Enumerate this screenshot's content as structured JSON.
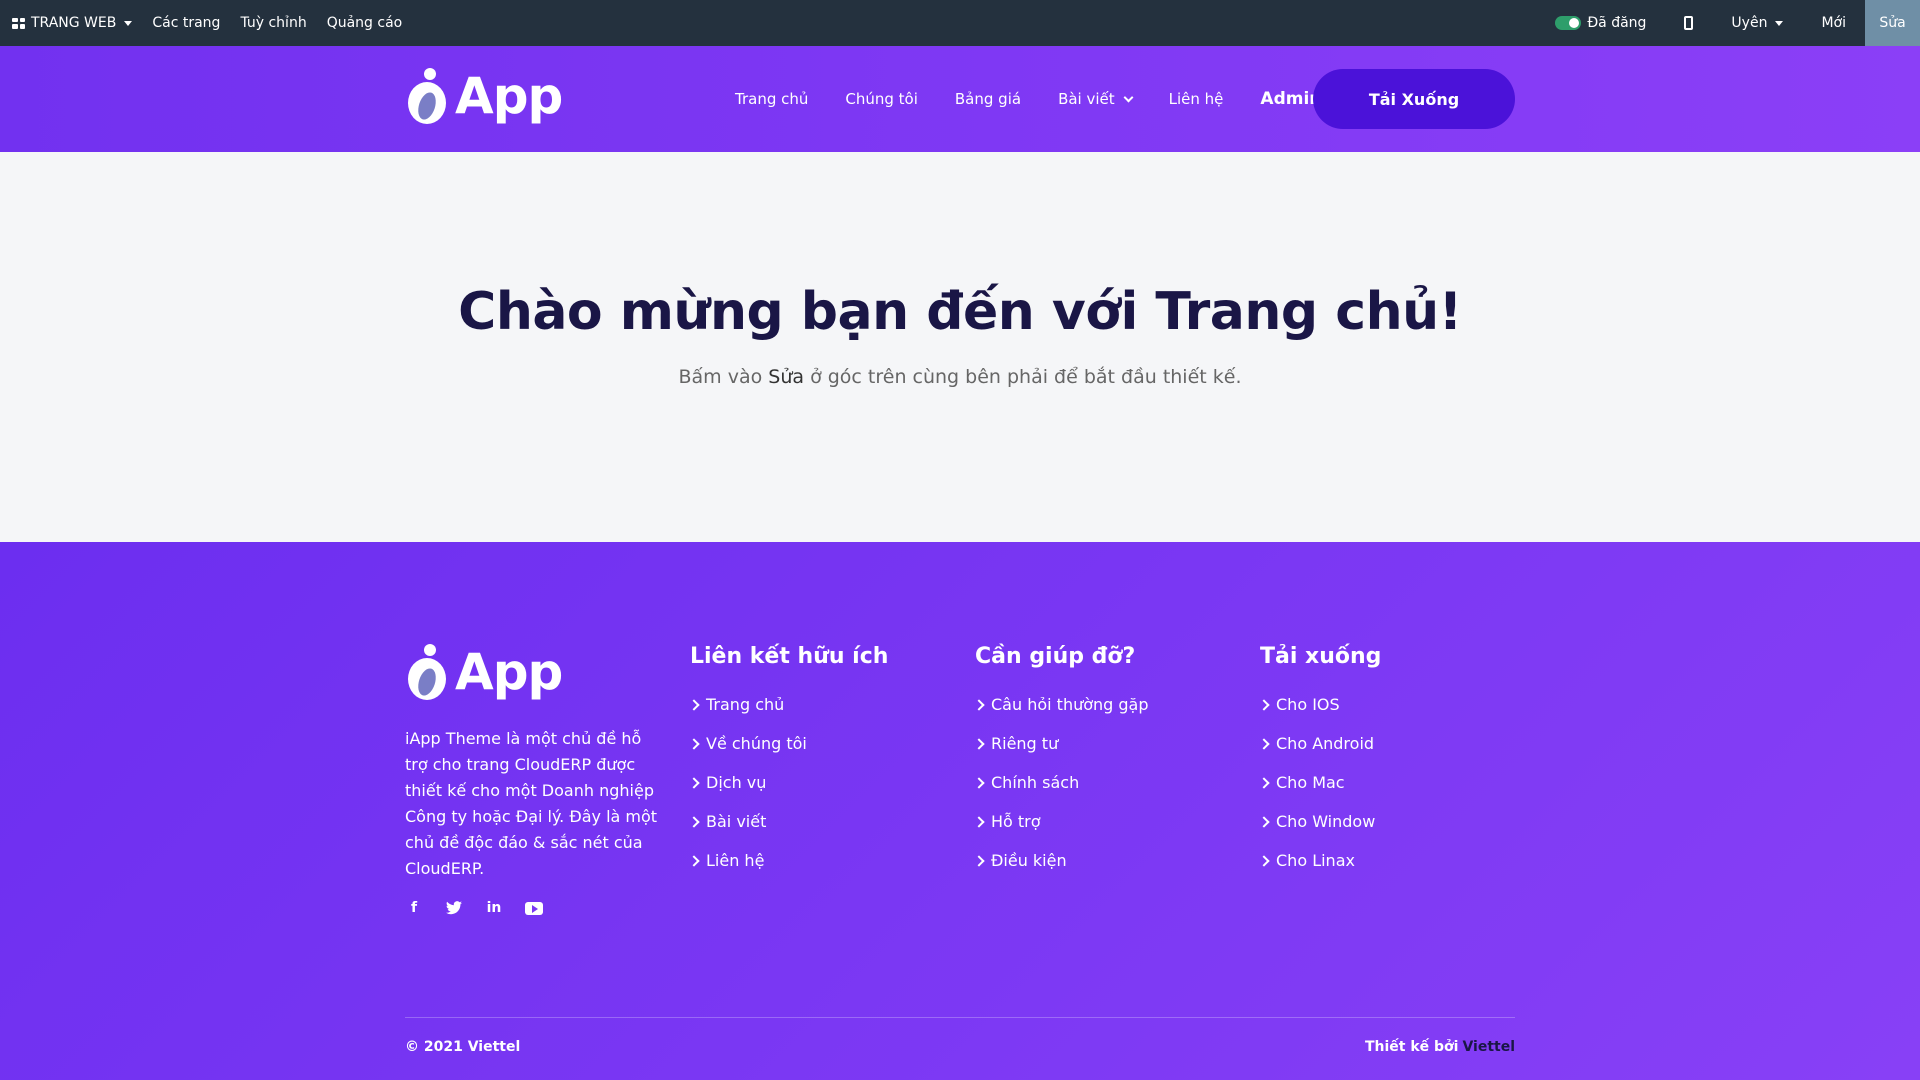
{
  "adminbar": {
    "site_label": "TRANG WEB",
    "pages": "Các trang",
    "customize": "Tuỳ chỉnh",
    "ads": "Quảng cáo",
    "published": "Đã đăng",
    "user": "Uyên",
    "new": "Mới",
    "edit": "Sửa"
  },
  "header": {
    "logo_text": "App",
    "nav": [
      "Trang chủ",
      "Chúng tôi",
      "Bảng giá",
      "Bài viết",
      "Liên hệ",
      "Admin"
    ],
    "download": "Tải Xuống"
  },
  "hero": {
    "title": "Chào mừng bạn đến với Trang chủ!",
    "subtitle_before": "Bấm vào ",
    "subtitle_bold": "Sửa",
    "subtitle_after": " ở góc trên cùng bên phải để bắt đầu thiết kế."
  },
  "footer": {
    "logo_text": "App",
    "about": "iApp Theme là một chủ đề hỗ trợ cho trang CloudERP được thiết kế cho một Doanh nghiệp Công ty hoặc Đại lý. Đây là một chủ đề độc đáo & sắc nét của CloudERP.",
    "columns": [
      {
        "title": "Liên kết hữu ích",
        "links": [
          "Trang chủ",
          "Về chúng tôi",
          "Dịch vụ",
          "Bài viết",
          "Liên hệ"
        ]
      },
      {
        "title": "Cần giúp đỡ?",
        "links": [
          "Câu hỏi thường gặp",
          "Riêng tư",
          "Chính sách",
          "Hỗ trợ",
          "Điều kiện"
        ]
      },
      {
        "title": "Tải xuống",
        "links": [
          "Cho IOS",
          "Cho Android",
          "Cho Mac",
          "Cho Window",
          "Cho Linax"
        ]
      }
    ],
    "socials": [
      "facebook-icon",
      "twitter-icon",
      "linkedin-icon",
      "youtube-icon"
    ],
    "copyright": "© 2021 Viettel",
    "credit_prefix": "Thiết kế bởi",
    "credit_brand": "Viettel"
  }
}
